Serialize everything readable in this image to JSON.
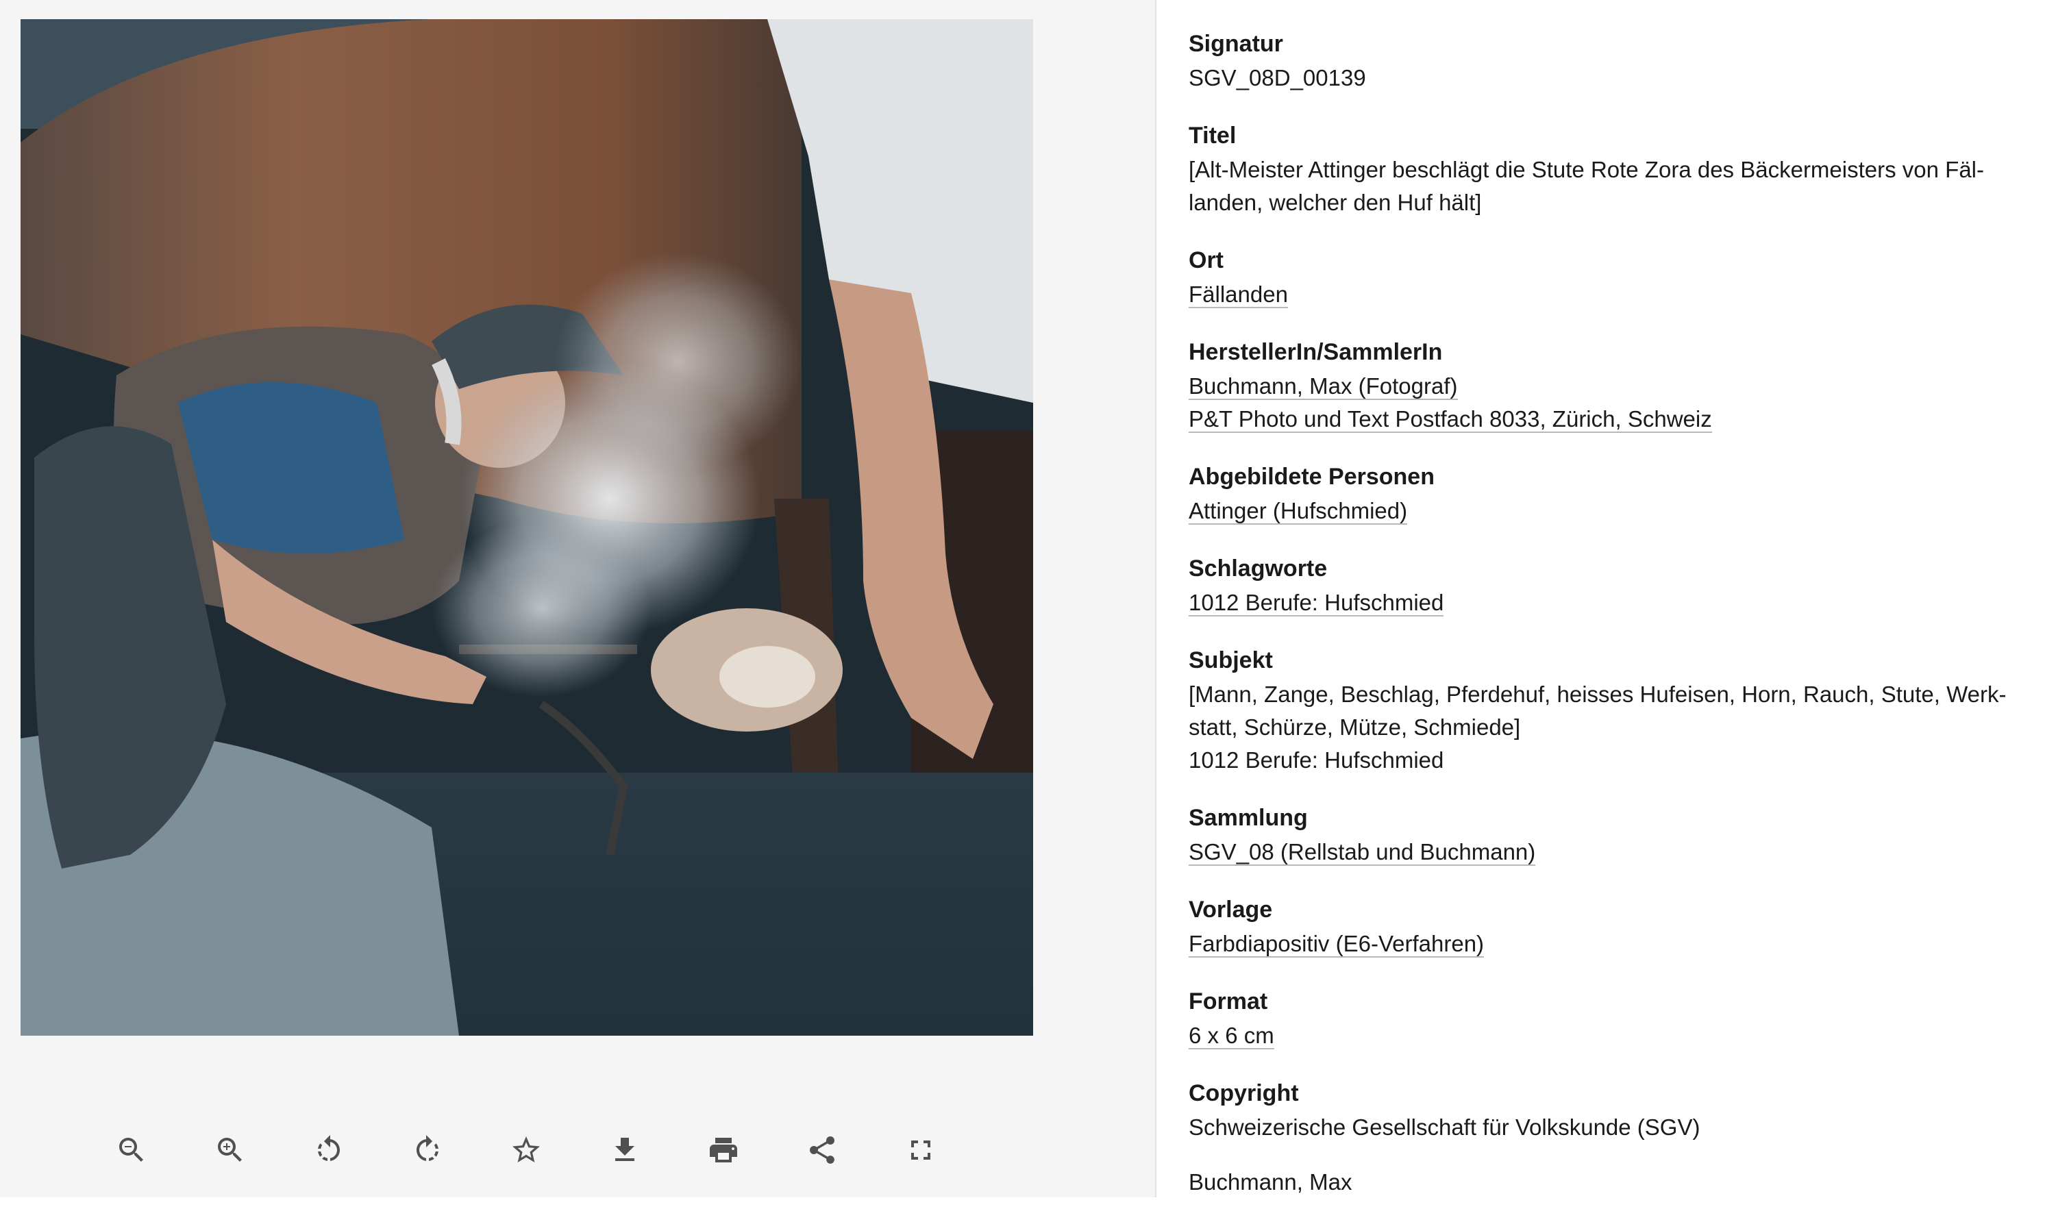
{
  "toolbar": {
    "buttons": [
      {
        "name": "zoom-out"
      },
      {
        "name": "zoom-in"
      },
      {
        "name": "rotate-left"
      },
      {
        "name": "rotate-right"
      },
      {
        "name": "favorite"
      },
      {
        "name": "download"
      },
      {
        "name": "print"
      },
      {
        "name": "share"
      },
      {
        "name": "fullscreen"
      }
    ]
  },
  "metadata": {
    "signatur": {
      "label": "Signatur",
      "value": "SGV_08D_00139"
    },
    "titel": {
      "label": "Titel",
      "line1": "[Alt-Meister Attinger beschlägt die Stute Rote Zora des Bäckermeisters von Fäl-",
      "line2": "landen, welcher den Huf hält]"
    },
    "ort": {
      "label": "Ort",
      "value": "Fällanden"
    },
    "hersteller": {
      "label": "HerstellerIn/SammlerIn",
      "value1": "Buchmann, Max (Fotograf)",
      "value2": "P&T Photo und Text Postfach 8033, Zürich, Schweiz"
    },
    "personen": {
      "label": "Abgebildete Personen",
      "value": "Attinger (Hufschmied)"
    },
    "schlagworte": {
      "label": "Schlagworte",
      "value": "1012 Berufe: Hufschmied"
    },
    "subjekt": {
      "label": "Subjekt",
      "line1": "[Mann, Zange, Beschlag, Pferdehuf, heisses Hufeisen, Horn, Rauch, Stute, Werk-",
      "line2": "statt, Schürze, Mütze, Schmiede]",
      "line3": "1012 Berufe: Hufschmied"
    },
    "sammlung": {
      "label": "Sammlung",
      "value": "SGV_08 (Rellstab und Buchmann)"
    },
    "vorlage": {
      "label": "Vorlage",
      "value": "Farbdiapositiv (E6-Verfahren)"
    },
    "format": {
      "label": "Format",
      "value": "6 x 6 cm"
    },
    "copyright": {
      "label": "Copyright",
      "value1": "Schweizerische Gesellschaft für Volkskunde (SGV)",
      "value2": "Buchmann, Max"
    }
  }
}
